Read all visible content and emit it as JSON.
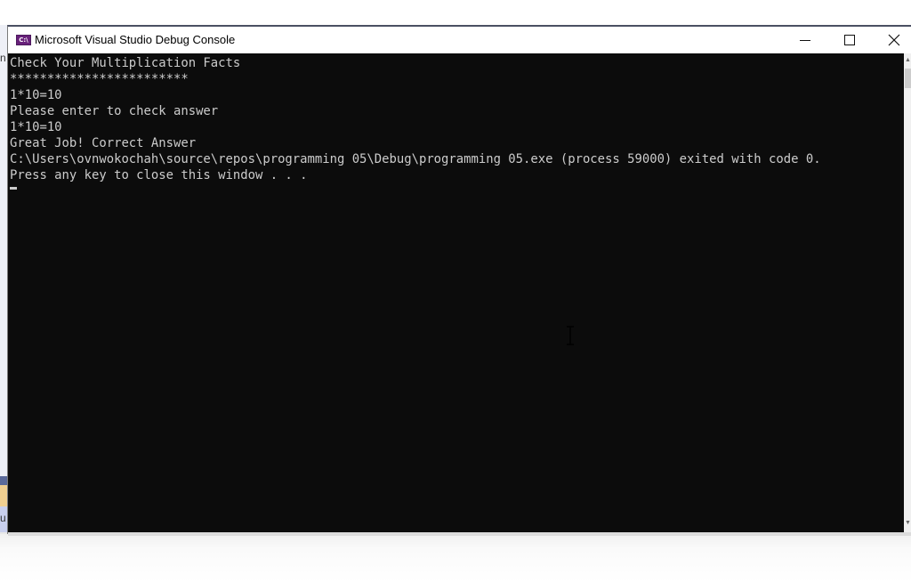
{
  "window": {
    "title": "Microsoft Visual Studio Debug Console",
    "icon": "console-app-icon",
    "icon_label": "C:\\",
    "controls": {
      "minimize": "minimize-icon",
      "maximize": "maximize-icon",
      "close": "close-icon"
    }
  },
  "console": {
    "lines": [
      "Check Your Multiplication Facts",
      "************************",
      "1*10=10",
      "Please enter to check answer",
      "1*10=10",
      "Great Job! Correct Answer",
      "C:\\Users\\ovnwokochah\\source\\repos\\programming 05\\Debug\\programming 05.exe (process 59000) exited with code 0.",
      "Press any key to close this window . . ."
    ],
    "background": "#0c0c0c",
    "foreground": "#cccccc"
  },
  "scrollbar": {
    "up": "scroll-up-arrow-icon",
    "down": "scroll-down-arrow-icon"
  },
  "background_app": {
    "fragment_top": "n",
    "fragment_bottom": "u"
  }
}
